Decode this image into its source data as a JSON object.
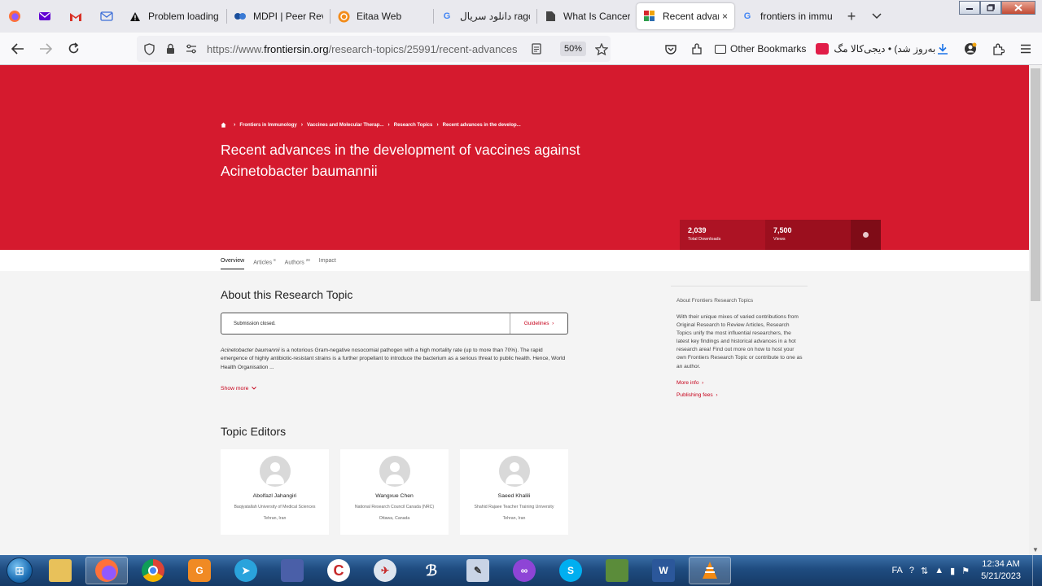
{
  "browser": {
    "tabs": [
      {
        "title": "Problem loading",
        "icon": "warning-icon",
        "active": false
      },
      {
        "title": "MDPI | Peer Revie",
        "icon": "mdpi-icon",
        "active": false
      },
      {
        "title": "Eitaa Web",
        "icon": "eitaa-icon",
        "active": false
      },
      {
        "title": "دانلود سریال ragon",
        "icon": "google-icon",
        "active": false
      },
      {
        "title": "What Is Cancer? -",
        "icon": "page-icon",
        "active": false
      },
      {
        "title": "Recent advance",
        "icon": "frontiers-icon",
        "active": true
      },
      {
        "title": "frontiers in immu",
        "icon": "google-icon",
        "active": false
      }
    ],
    "tab_close": "×",
    "new_tab": "+",
    "url_prefix": "https://www.",
    "url_domain": "frontiersin.org",
    "url_rest": "/research-topics/25991/recent-advances",
    "zoom": "50%",
    "bookmarks": {
      "other": "Other Bookmarks",
      "digikala": "به‌روز شد) • دیجی‌کالا مگ"
    }
  },
  "page": {
    "breadcrumbs": [
      "Frontiers in Immunology",
      "Vaccines and Molecular Therap...",
      "Research Topics",
      "Recent advances in the develop..."
    ],
    "title": "Recent advances in the development of vaccines against Acinetobacter baumannii",
    "stats": {
      "downloads_value": "2,039",
      "downloads_label": "Total Downloads",
      "views_value": "7,500",
      "views_label": "Views"
    },
    "subnav": {
      "overview": "Overview",
      "articles": "Articles",
      "articles_count": "8",
      "authors": "Authors",
      "authors_count": "28",
      "impact": "Impact"
    },
    "about_heading": "About this Research Topic",
    "submission_status": "Submission closed.",
    "guidelines_label": "Guidelines",
    "abstract_italic": "Acinetobacter baumannii",
    "abstract_rest": " is a notorious Gram-negative nosocomial pathogen with a high mortality rate (up to more than 70%). The rapid emergence of highly antibiotic-resistant strains is a further propellant to introduce the bacterium as a serious threat to public health. Hence, World Health Organisation ...",
    "show_more": "Show more",
    "editors_heading": "Topic Editors",
    "editors": [
      {
        "name": "Abolfazl Jahangiri",
        "affiliation": "Baqiyatallah University of Medical Sciences",
        "location": "Tehran, Iran"
      },
      {
        "name": "Wangxue Chen",
        "affiliation": "National Research Council Canada (NRC)",
        "location": "Ottawa, Canada"
      },
      {
        "name": "Saeed Khalili",
        "affiliation": "Shahid Rajaee Teacher Training University",
        "location": "Tehran, Iran"
      }
    ],
    "sidebar": {
      "heading": "About Frontiers Research Topics",
      "text": "With their unique mixes of varied contributions from Original Research to Review Articles, Research Topics unify the most influential researchers, the latest key findings and historical advances in a hot research area! Find out more on how to host your own Frontiers Research Topic or contribute to one as an author.",
      "more_info": "More info",
      "publishing_fees": "Publishing fees"
    }
  },
  "taskbar": {
    "lang": "FA",
    "time": "12:34 AM",
    "date": "5/21/2023",
    "apps": [
      "explorer-icon",
      "firefox-icon",
      "chrome-icon",
      "pdf-icon",
      "telegram-icon",
      "app-icon",
      "ccleaner-icon",
      "network-icon",
      "solidworks-icon",
      "editor-icon",
      "vpn-icon",
      "skype-icon",
      "monitor-icon",
      "word-icon",
      "vlc-icon"
    ]
  },
  "colors": {
    "brand_red": "#d51a2e",
    "link_red": "#c6001a"
  }
}
